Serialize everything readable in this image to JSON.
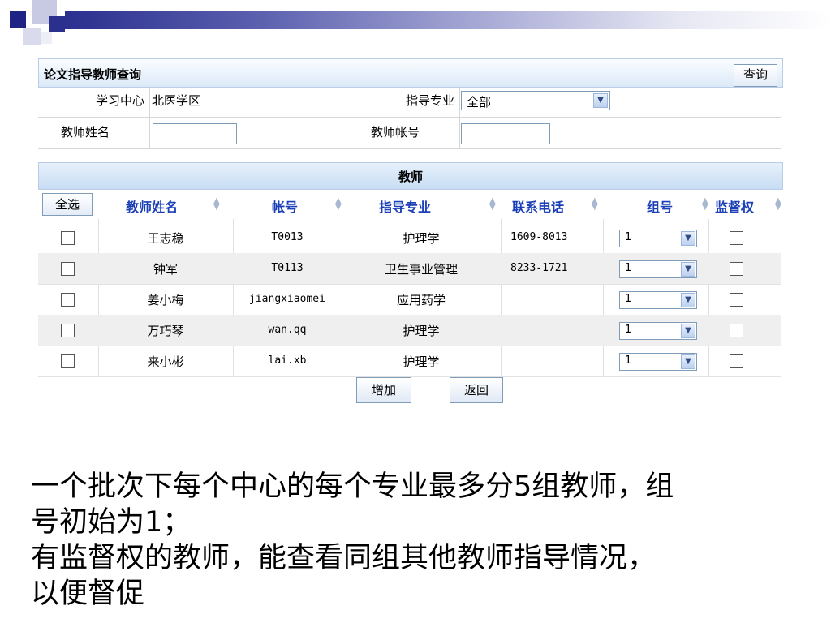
{
  "panel": {
    "title": "论文指导教师查询",
    "query_button": "查询",
    "filters": {
      "study_center_label": "学习中心",
      "study_center_value": "北医学区",
      "major_label": "指导专业",
      "major_value": "全部",
      "teacher_name_label": "教师姓名",
      "teacher_name_value": "",
      "teacher_account_label": "教师帐号",
      "teacher_account_value": ""
    },
    "section_title": "教师",
    "select_all_button": "全选",
    "columns": [
      "教师姓名",
      "帐号",
      "指导专业",
      "联系电话",
      "组号",
      "监督权"
    ],
    "rows": [
      {
        "name": "王志稳",
        "account": "T0013",
        "major": "护理学",
        "phone": "1609-8013",
        "group": "1"
      },
      {
        "name": "钟军",
        "account": "T0113",
        "major": "卫生事业管理",
        "phone": "8233-1721",
        "group": "1"
      },
      {
        "name": "姜小梅",
        "account": "jiangxiaomei",
        "major": "应用药学",
        "phone": "",
        "group": "1"
      },
      {
        "name": "万巧琴",
        "account": "wan.qq",
        "major": "护理学",
        "phone": "",
        "group": "1"
      },
      {
        "name": "来小彬",
        "account": "lai.xb",
        "major": "护理学",
        "phone": "",
        "group": "1"
      }
    ],
    "add_button": "增加",
    "back_button": "返回"
  },
  "notes": {
    "line1": "一个批次下每个中心的每个专业最多分5组教师，组",
    "line2": "号初始为1；",
    "line3": "有监督权的教师，能查看同组其他教师指导情况，",
    "line4": "以便督促"
  },
  "colors": {
    "deco_dark": "#1f2383",
    "link": "#1a3fb7",
    "header_gradient_light": "#e6f0fb",
    "row_alt": "#efefef"
  }
}
